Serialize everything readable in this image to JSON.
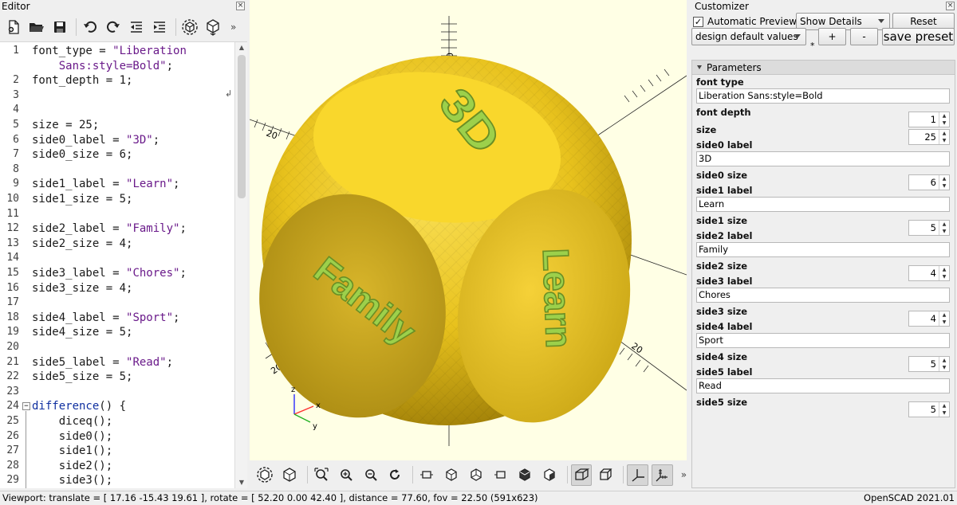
{
  "editor": {
    "title": "Editor",
    "close_glyph": "×",
    "more_glyph": "»",
    "lines": [
      {
        "n": "1",
        "segments": [
          {
            "t": "font_type = "
          },
          {
            "t": "\"Liberation",
            "c": "str"
          }
        ]
      },
      {
        "n": "",
        "segments": [
          {
            "t": "    "
          },
          {
            "t": "Sans:style=Bold\"",
            "c": "str"
          },
          {
            "t": ";"
          }
        ]
      },
      {
        "n": "2",
        "segments": [
          {
            "t": "font_depth = 1;"
          }
        ]
      },
      {
        "n": "3",
        "segments": []
      },
      {
        "n": "4",
        "segments": []
      },
      {
        "n": "5",
        "segments": [
          {
            "t": "size = 25;"
          }
        ]
      },
      {
        "n": "6",
        "segments": [
          {
            "t": "side0_label = "
          },
          {
            "t": "\"3D\"",
            "c": "str"
          },
          {
            "t": ";"
          }
        ]
      },
      {
        "n": "7",
        "segments": [
          {
            "t": "side0_size = 6;"
          }
        ]
      },
      {
        "n": "8",
        "segments": []
      },
      {
        "n": "9",
        "segments": [
          {
            "t": "side1_label = "
          },
          {
            "t": "\"Learn\"",
            "c": "str"
          },
          {
            "t": ";"
          }
        ]
      },
      {
        "n": "10",
        "segments": [
          {
            "t": "side1_size = 5;"
          }
        ]
      },
      {
        "n": "11",
        "segments": []
      },
      {
        "n": "12",
        "segments": [
          {
            "t": "side2_label = "
          },
          {
            "t": "\"Family\"",
            "c": "str"
          },
          {
            "t": ";"
          }
        ]
      },
      {
        "n": "13",
        "segments": [
          {
            "t": "side2_size = 4;"
          }
        ]
      },
      {
        "n": "14",
        "segments": []
      },
      {
        "n": "15",
        "segments": [
          {
            "t": "side3_label = "
          },
          {
            "t": "\"Chores\"",
            "c": "str"
          },
          {
            "t": ";"
          }
        ]
      },
      {
        "n": "16",
        "segments": [
          {
            "t": "side3_size = 4;"
          }
        ]
      },
      {
        "n": "17",
        "segments": []
      },
      {
        "n": "18",
        "segments": [
          {
            "t": "side4_label = "
          },
          {
            "t": "\"Sport\"",
            "c": "str"
          },
          {
            "t": ";"
          }
        ]
      },
      {
        "n": "19",
        "segments": [
          {
            "t": "side4_size = 5;"
          }
        ]
      },
      {
        "n": "20",
        "segments": []
      },
      {
        "n": "21",
        "segments": [
          {
            "t": "side5_label = "
          },
          {
            "t": "\"Read\"",
            "c": "str"
          },
          {
            "t": ";"
          }
        ]
      },
      {
        "n": "22",
        "segments": [
          {
            "t": "side5_size = 5;"
          }
        ]
      },
      {
        "n": "23",
        "segments": []
      },
      {
        "n": "24",
        "segments": [
          {
            "t": "difference",
            "c": "kw"
          },
          {
            "t": "() {"
          }
        ],
        "fold": true
      },
      {
        "n": "25",
        "segments": [
          {
            "t": "    diceq();"
          }
        ]
      },
      {
        "n": "26",
        "segments": [
          {
            "t": "    side0();"
          }
        ]
      },
      {
        "n": "27",
        "segments": [
          {
            "t": "    side1();"
          }
        ]
      },
      {
        "n": "28",
        "segments": [
          {
            "t": "    side2();"
          }
        ]
      },
      {
        "n": "29",
        "segments": [
          {
            "t": "    side3();"
          }
        ]
      }
    ]
  },
  "viewport": {
    "background": "#ffffe5",
    "dice_color": "#f9d72c",
    "cut_color": "#9cd04b",
    "face_labels": {
      "top": "3D",
      "left": "Family",
      "right": "Learn"
    },
    "axis_tick_labels": [
      "20",
      "20",
      "20",
      "20"
    ],
    "axis_gizmo": {
      "x": "x",
      "y": "y",
      "z": "z"
    }
  },
  "customizer": {
    "title": "Customizer",
    "close_glyph": "×",
    "automatic_preview": {
      "label": "Automatic Preview",
      "checked_glyph": "✓"
    },
    "show_details": "Show Details",
    "reset_label": "Reset",
    "preset": "design default values",
    "asterisk": "*",
    "plus_label": "+",
    "minus_label": "-",
    "save_preset_label": "save preset",
    "parameters_title": "Parameters",
    "params": [
      {
        "label": "font type",
        "kind": "text",
        "value": "Liberation Sans:style=Bold"
      },
      {
        "label": "font depth",
        "kind": "spin",
        "value": "1"
      },
      {
        "label": "size",
        "kind": "spin",
        "value": "25"
      },
      {
        "label": "side0 label",
        "kind": "text",
        "value": "3D"
      },
      {
        "label": "side0 size",
        "kind": "spin",
        "value": "6"
      },
      {
        "label": "side1 label",
        "kind": "text",
        "value": "Learn"
      },
      {
        "label": "side1 size",
        "kind": "spin",
        "value": "5"
      },
      {
        "label": "side2 label",
        "kind": "text",
        "value": "Family"
      },
      {
        "label": "side2 size",
        "kind": "spin",
        "value": "4"
      },
      {
        "label": "side3 label",
        "kind": "text",
        "value": "Chores"
      },
      {
        "label": "side3 size",
        "kind": "spin",
        "value": "4"
      },
      {
        "label": "side4 label",
        "kind": "text",
        "value": "Sport"
      },
      {
        "label": "side4 size",
        "kind": "spin",
        "value": "5"
      },
      {
        "label": "side5 label",
        "kind": "text",
        "value": "Read"
      },
      {
        "label": "side5 size",
        "kind": "spin",
        "value": "5"
      }
    ]
  },
  "statusbar": {
    "viewport_info": "Viewport: translate = [ 17.16 -15.43 19.61 ], rotate = [ 52.20 0.00 42.40 ], distance = 77.60, fov = 22.50 (591x623)",
    "version": "OpenSCAD 2021.01"
  }
}
